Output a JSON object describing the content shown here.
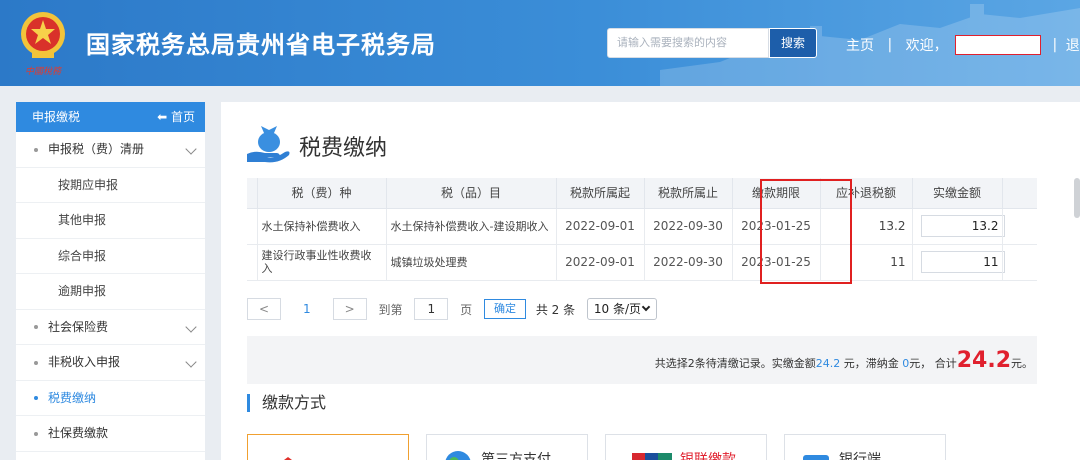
{
  "header": {
    "site_title": "国家税务总局贵州省电子税务局",
    "search_placeholder": "请输入需要搜索的内容",
    "search_button": "搜索",
    "home_link": "主页",
    "welcome": "欢迎，",
    "logout": "退出",
    "separator": "|"
  },
  "sidebar": {
    "header": "申报缴税",
    "home_label": "首页",
    "items": [
      {
        "label": "申报税（费）清册",
        "type": "group"
      },
      {
        "label": "按期应申报",
        "type": "sub"
      },
      {
        "label": "其他申报",
        "type": "sub"
      },
      {
        "label": "综合申报",
        "type": "sub"
      },
      {
        "label": "逾期申报",
        "type": "sub"
      },
      {
        "label": "社会保险费",
        "type": "group"
      },
      {
        "label": "非税收入申报",
        "type": "group"
      },
      {
        "label": "税费缴纳",
        "type": "active"
      },
      {
        "label": "社保费缴款",
        "type": "item"
      }
    ]
  },
  "main": {
    "title": "税费缴纳",
    "table": {
      "headers": [
        "税（费）种",
        "税（品）目",
        "税款所属起",
        "税款所属止",
        "缴款期限",
        "应补退税额",
        "实缴金额"
      ],
      "rows": [
        {
          "tax_type": "水土保持补偿费收入",
          "tax_item": "水土保持补偿费收入-建设期收入",
          "start": "2022-09-01",
          "end": "2022-09-30",
          "deadline": "2023-01-25",
          "due": "13.2",
          "paid": "13.2"
        },
        {
          "tax_type": "建设行政事业性收费收入",
          "tax_item": "城镇垃圾处理费",
          "start": "2022-09-01",
          "end": "2022-09-30",
          "deadline": "2023-01-25",
          "due": "11",
          "paid": "11"
        }
      ]
    },
    "pager": {
      "prev": "<",
      "current": "1",
      "next": ">",
      "goto_label": "到第",
      "page_input": "1",
      "page_unit": "页",
      "confirm": "确定",
      "total": "共 2 条",
      "page_size": "10 条/页"
    },
    "summary": {
      "prefix": "共选择2条待清缴记录。实缴金额",
      "paid_amount": "24.2",
      "mid1": " 元，滞纳金 ",
      "late_fee": "0",
      "mid2": "元， 合计",
      "total": "24.2",
      "suffix": "元。"
    },
    "payment": {
      "title": "缴款方式",
      "methods": [
        "",
        "第三方支付",
        "银联缴款",
        "银行端"
      ]
    }
  },
  "colors": {
    "header_blue": "#2c79c8",
    "accent_blue": "#2f8ae0",
    "highlight_red": "#e02020",
    "total_red": "#e0202e"
  }
}
